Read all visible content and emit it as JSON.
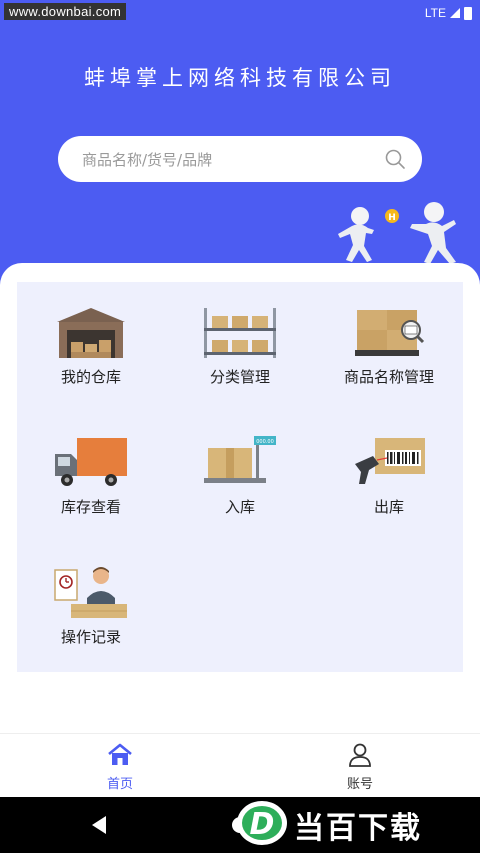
{
  "status_bar": {
    "watermark": "www.downbai.com",
    "network": "LTE"
  },
  "header": {
    "company_name": "蚌埠掌上网络科技有限公司",
    "search_placeholder": "商品名称/货号/品牌"
  },
  "menu": {
    "items": [
      {
        "label": "我的仓库",
        "icon": "warehouse-icon"
      },
      {
        "label": "分类管理",
        "icon": "shelf-icon"
      },
      {
        "label": "商品名称管理",
        "icon": "pallet-icon"
      },
      {
        "label": "库存查看",
        "icon": "truck-icon"
      },
      {
        "label": "入库",
        "icon": "scale-icon"
      },
      {
        "label": "出库",
        "icon": "scanner-icon"
      },
      {
        "label": "操作记录",
        "icon": "worker-icon"
      }
    ]
  },
  "tabbar": {
    "home_label": "首页",
    "account_label": "账号"
  },
  "watermark_logo": {
    "letter": "D",
    "text": "当百下载"
  },
  "colors": {
    "brand": "#4c5cf2",
    "grid_bg": "#eef0fd",
    "tab_active": "#4c5cf2",
    "tab_inactive": "#333333"
  }
}
